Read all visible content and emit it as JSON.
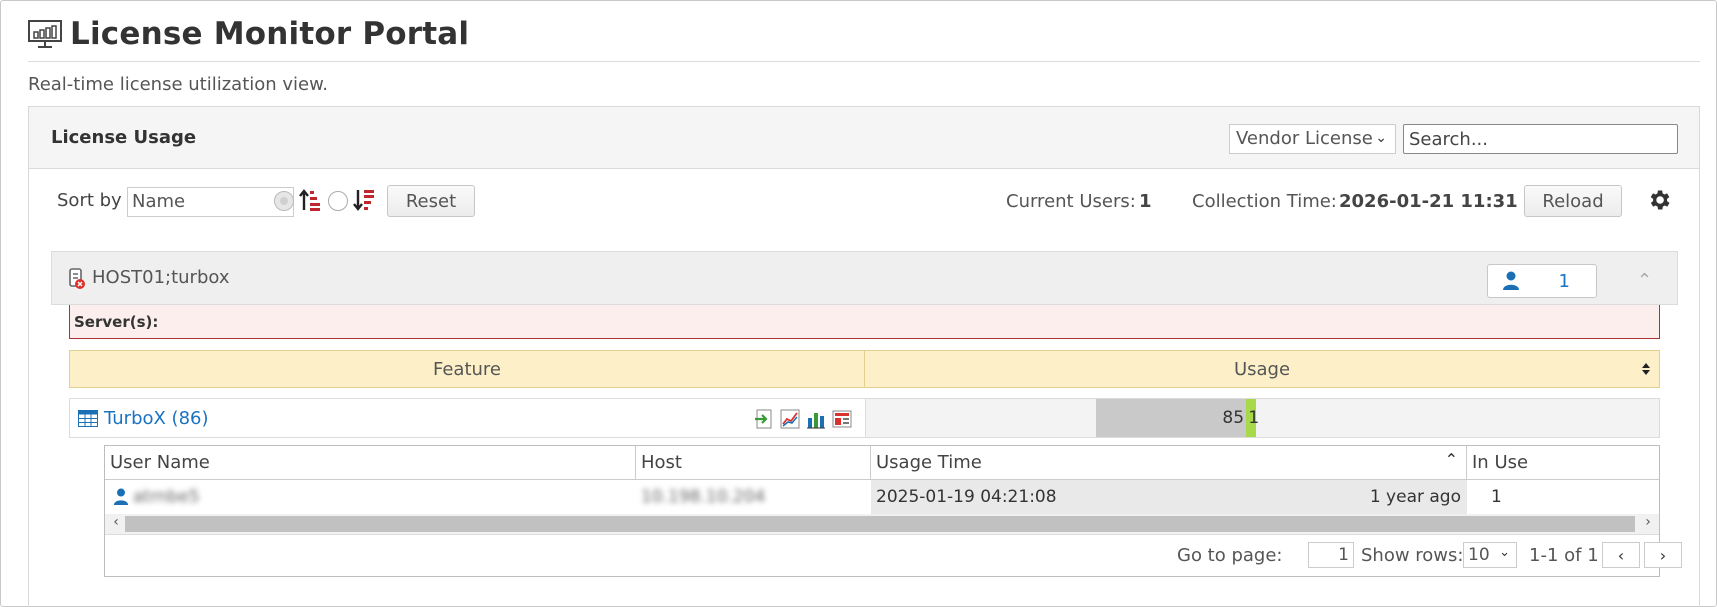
{
  "header": {
    "title": "License Monitor Portal",
    "subtitle": "Real-time license utilization view."
  },
  "panel": {
    "title": "License Usage",
    "vendor_select": "Vendor License",
    "search_placeholder": "Search..."
  },
  "toolbar": {
    "sort_label": "Sort by",
    "sort_value": "Name",
    "reset_label": "Reset",
    "current_users_label": "Current Users:",
    "current_users_value": "1",
    "collection_time_label": "Collection Time:",
    "collection_time_value": "2026-01-21 11:31",
    "reload_label": "Reload"
  },
  "host": {
    "name": "HOST01;turbox",
    "user_count": "1",
    "servers_label": "Server(s):"
  },
  "features_table": {
    "columns": [
      "Feature",
      "Usage"
    ],
    "rows": [
      {
        "feature": "TurboX (86)",
        "available": "85",
        "in_use": "1",
        "total": 86
      }
    ]
  },
  "users_table": {
    "columns": [
      "User Name",
      "Host",
      "Usage Time",
      "In Use"
    ],
    "rows": [
      {
        "user": "atrnbe5",
        "host": "10.198.10.204",
        "usage_time": "2025-01-19 04:21:08",
        "relative_time": "1 year ago",
        "in_use": "1"
      }
    ]
  },
  "pager": {
    "go_to_page_label": "Go to page:",
    "page_value": "1",
    "show_rows_label": "Show rows:",
    "rows_value": "10",
    "range": "1-1 of 1"
  },
  "colors": {
    "link": "#1a73c2",
    "usage_used": "#a7d94a",
    "usage_available": "#c9c9c9",
    "header_yellow": "#fdf0c9",
    "server_alert_bg": "#fdeeee"
  },
  "icons": {
    "logo": "monitor-chart-icon",
    "host": "server-error-icon",
    "user": "user-icon",
    "settings": "gear-icon",
    "feature": "table-icon"
  }
}
